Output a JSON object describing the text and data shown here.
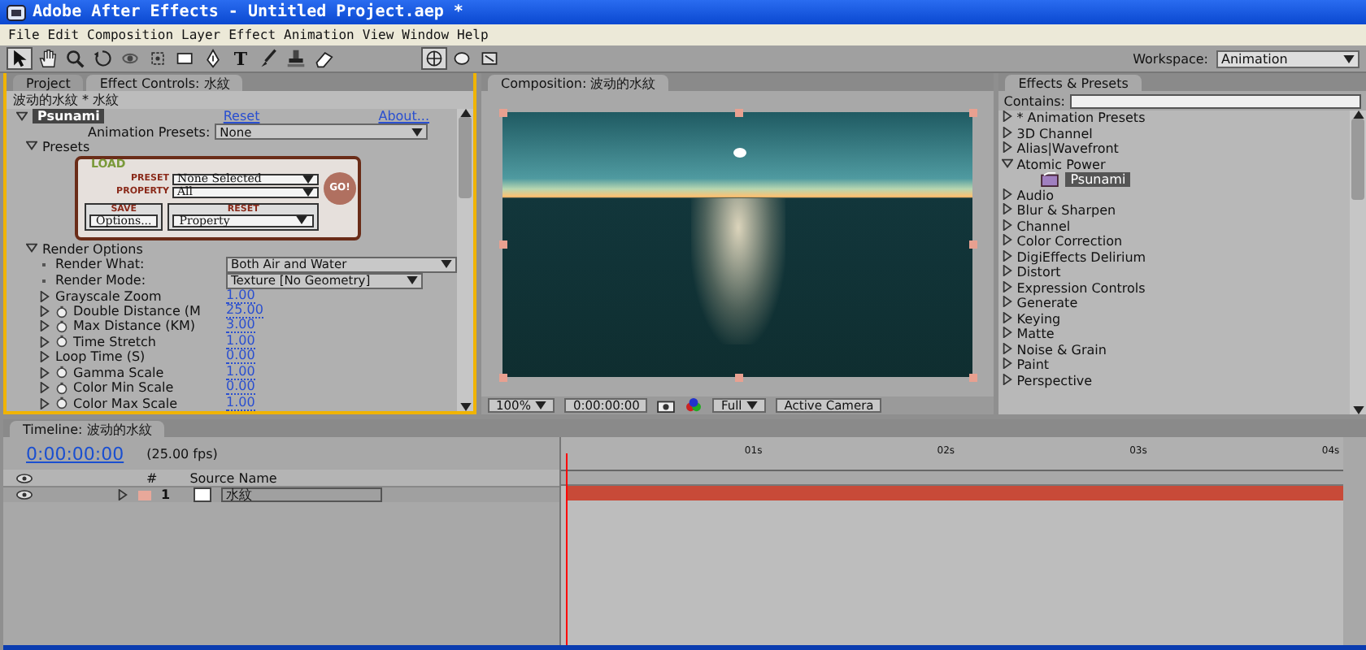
{
  "window": {
    "title": "Adobe After Effects - Untitled Project.aep *"
  },
  "menu": [
    "File",
    "Edit",
    "Composition",
    "Layer",
    "Effect",
    "Animation",
    "View",
    "Window",
    "Help"
  ],
  "tools": [
    {
      "kind": "arrow",
      "selected": true
    },
    {
      "kind": "hand",
      "selected": false
    },
    {
      "kind": "zoom",
      "selected": false
    },
    {
      "kind": "rotate",
      "selected": false
    },
    {
      "kind": "orbit",
      "selected": false
    },
    {
      "kind": "move",
      "selected": false
    },
    {
      "kind": "rectangle",
      "selected": false
    },
    {
      "kind": "pen",
      "selected": false
    },
    {
      "kind": "text",
      "label": "T",
      "selected": false
    },
    {
      "kind": "brush",
      "selected": false
    },
    {
      "kind": "stamp",
      "selected": false
    },
    {
      "kind": "eraser",
      "selected": false
    }
  ],
  "axis_tools": [
    {
      "kind": "axis",
      "selected": true
    },
    {
      "kind": "world",
      "selected": false
    },
    {
      "kind": "view",
      "selected": false
    }
  ],
  "workspace": {
    "label": "Workspace:",
    "value": "Animation"
  },
  "effect_controls": {
    "tabs": [
      {
        "label": "Project",
        "selected": false
      },
      {
        "label": "Effect Controls: 水紋",
        "selected": true
      }
    ],
    "header": "波动的水紋 * 水紋",
    "effect": {
      "name": "Psunami",
      "reset": "Reset",
      "about": "About..."
    },
    "animation_presets": {
      "label": "Animation Presets:",
      "value": "None"
    },
    "presets_group": {
      "label": "Presets",
      "expanded": true
    },
    "preset_panel": {
      "load": "LOAD",
      "preset_label": "PRESET",
      "preset_value": "None Selected",
      "property_label": "PROPERTY",
      "property_value": "All",
      "go": "GO!",
      "save": "SAVE",
      "options": "Options...",
      "reset": "RESET",
      "reset_value": "Property"
    },
    "render_group": {
      "label": "Render Options",
      "expanded": true
    },
    "properties": [
      {
        "label": "Render What:",
        "value": "Both Air and Water",
        "kind": "dropdown",
        "indent": true,
        "stopwatch": false
      },
      {
        "label": "Render Mode:",
        "value": "Texture [No Geometry]",
        "kind": "dropdown",
        "indent": true,
        "stopwatch": false
      },
      {
        "label": "Grayscale Zoom",
        "value": "1.00",
        "kind": "number",
        "indent": false,
        "stopwatch": false
      },
      {
        "label": "Double Distance (M",
        "value": "25.00",
        "kind": "number",
        "indent": false,
        "stopwatch": true
      },
      {
        "label": "Max Distance (KM)",
        "value": "3.00",
        "kind": "number",
        "indent": false,
        "stopwatch": true
      },
      {
        "label": "Time Stretch",
        "value": "1.00",
        "kind": "number",
        "indent": false,
        "stopwatch": true
      },
      {
        "label": "Loop Time (S)",
        "value": "0.00",
        "kind": "number",
        "indent": false,
        "stopwatch": false
      },
      {
        "label": "Gamma Scale",
        "value": "1.00",
        "kind": "number",
        "indent": false,
        "stopwatch": true
      },
      {
        "label": "Color Min Scale",
        "value": "0.00",
        "kind": "number",
        "indent": false,
        "stopwatch": true
      },
      {
        "label": "Color Max Scale",
        "value": "1.00",
        "kind": "number",
        "indent": false,
        "stopwatch": true
      }
    ]
  },
  "composition": {
    "tab": "Composition: 波动的水紋",
    "zoom": "100%",
    "time": "0:00:00:00",
    "resolution": "Full",
    "camera": "Active Camera"
  },
  "effects_presets": {
    "tab": "Effects & Presets",
    "search_label": "Contains:",
    "items": [
      {
        "label": "* Animation Presets",
        "expanded": false,
        "selected": false
      },
      {
        "label": "3D Channel",
        "expanded": false,
        "selected": false
      },
      {
        "label": "Alias|Wavefront",
        "expanded": false,
        "selected": false
      },
      {
        "label": "Atomic Power",
        "expanded": true,
        "selected": false,
        "children": [
          {
            "label": "Psunami",
            "selected": true
          }
        ]
      },
      {
        "label": "Audio",
        "expanded": false,
        "selected": false
      },
      {
        "label": "Blur & Sharpen",
        "expanded": false,
        "selected": false
      },
      {
        "label": "Channel",
        "expanded": false,
        "selected": false
      },
      {
        "label": "Color Correction",
        "expanded": false,
        "selected": false
      },
      {
        "label": "DigiEffects Delirium",
        "expanded": false,
        "selected": false
      },
      {
        "label": "Distort",
        "expanded": false,
        "selected": false
      },
      {
        "label": "Expression Controls",
        "expanded": false,
        "selected": false
      },
      {
        "label": "Generate",
        "expanded": false,
        "selected": false
      },
      {
        "label": "Keying",
        "expanded": false,
        "selected": false
      },
      {
        "label": "Matte",
        "expanded": false,
        "selected": false
      },
      {
        "label": "Noise & Grain",
        "expanded": false,
        "selected": false
      },
      {
        "label": "Paint",
        "expanded": false,
        "selected": false
      },
      {
        "label": "Perspective",
        "expanded": false,
        "selected": false
      }
    ]
  },
  "timeline": {
    "tab": "Timeline: 波动的水紋",
    "time": "0:00:00:00",
    "fps": "(25.00 fps)",
    "number_column": "#",
    "source_column": "Source Name",
    "ruler": [
      "01s",
      "02s",
      "03s",
      "04s"
    ],
    "layers": [
      {
        "number": "1",
        "name": "水紋",
        "color": "#e8a89a",
        "visible": true
      }
    ]
  }
}
